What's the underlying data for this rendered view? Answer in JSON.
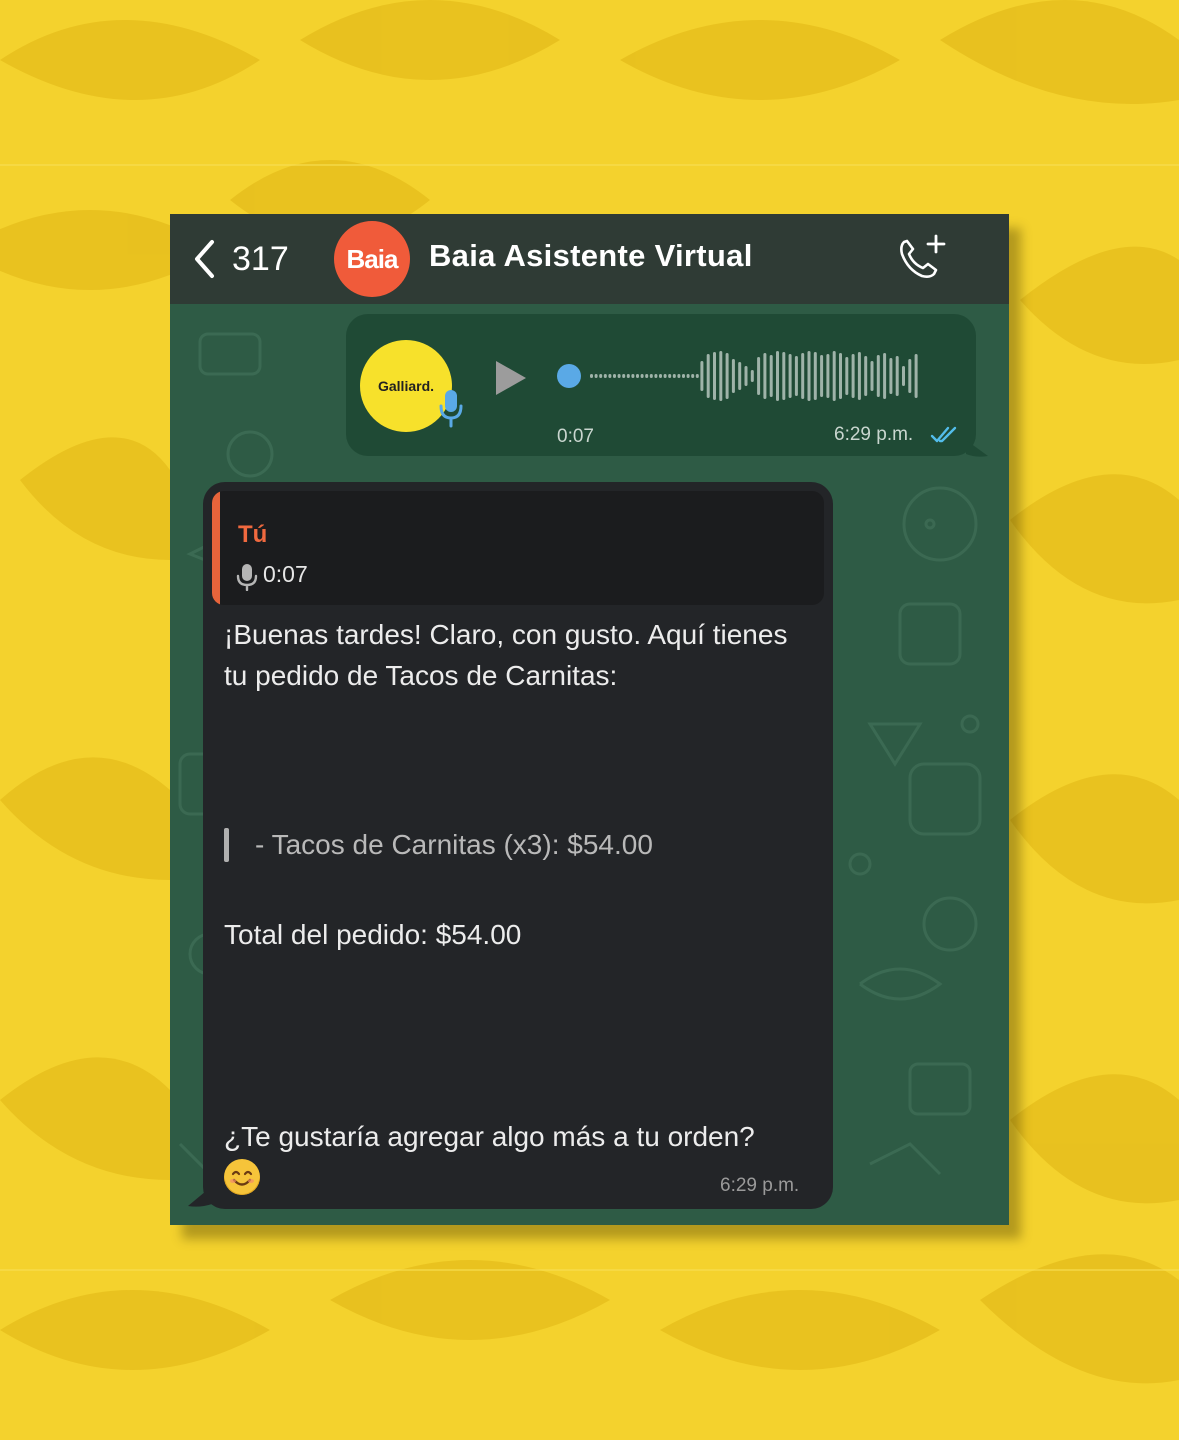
{
  "header": {
    "back_count": "317",
    "avatar_text": "Baia",
    "title": "Baia Asistente Virtual"
  },
  "voice_message": {
    "avatar_text": "Galliard.",
    "duration": "0:07",
    "time": "6:29 p.m.",
    "progress": 0.0
  },
  "reply_message": {
    "quote_author": "Tú",
    "quote_duration": "0:07",
    "line1": "¡Buenas tardes! Claro, con gusto. Aquí tienes tu pedido de Tacos de Carnitas:",
    "line2": "- Tacos de Carnitas (x3): $54.00",
    "line3": "Total del pedido: $54.00",
    "line4": "¿Te gustaría agregar algo más a tu orden?",
    "time": "6:29 p.m."
  },
  "colors": {
    "page_bg": "#f4d22d",
    "chat_bg": "#2e5b45",
    "topbar": "#2f3b35",
    "outgoing_bubble": "#1f4a35",
    "incoming_bubble": "#232528",
    "accent_orange": "#f0693f",
    "read_ticks": "#53bdeb"
  },
  "icons": [
    "chevron-left-icon",
    "add-call-icon",
    "play-icon",
    "mic-icon",
    "double-check-icon",
    "smile-emoji-icon"
  ]
}
